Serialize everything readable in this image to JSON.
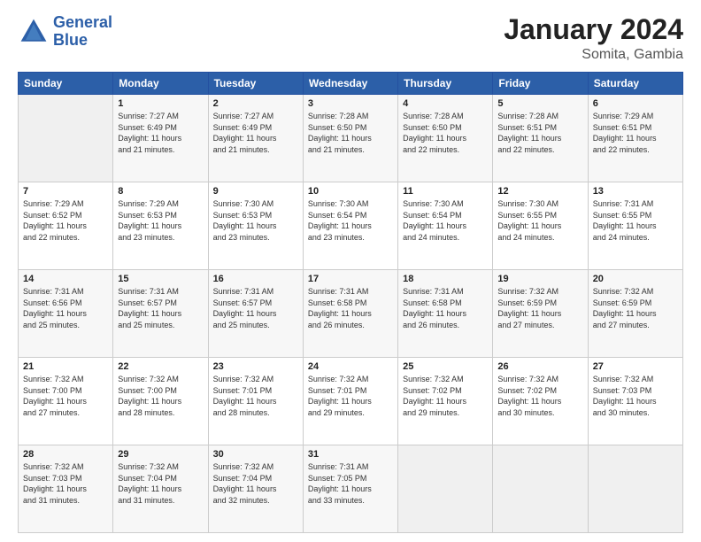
{
  "logo": {
    "line1": "General",
    "line2": "Blue"
  },
  "title": "January 2024",
  "subtitle": "Somita, Gambia",
  "days_header": [
    "Sunday",
    "Monday",
    "Tuesday",
    "Wednesday",
    "Thursday",
    "Friday",
    "Saturday"
  ],
  "weeks": [
    [
      {
        "day": "",
        "info": ""
      },
      {
        "day": "1",
        "info": "Sunrise: 7:27 AM\nSunset: 6:49 PM\nDaylight: 11 hours\nand 21 minutes."
      },
      {
        "day": "2",
        "info": "Sunrise: 7:27 AM\nSunset: 6:49 PM\nDaylight: 11 hours\nand 21 minutes."
      },
      {
        "day": "3",
        "info": "Sunrise: 7:28 AM\nSunset: 6:50 PM\nDaylight: 11 hours\nand 21 minutes."
      },
      {
        "day": "4",
        "info": "Sunrise: 7:28 AM\nSunset: 6:50 PM\nDaylight: 11 hours\nand 22 minutes."
      },
      {
        "day": "5",
        "info": "Sunrise: 7:28 AM\nSunset: 6:51 PM\nDaylight: 11 hours\nand 22 minutes."
      },
      {
        "day": "6",
        "info": "Sunrise: 7:29 AM\nSunset: 6:51 PM\nDaylight: 11 hours\nand 22 minutes."
      }
    ],
    [
      {
        "day": "7",
        "info": "Sunrise: 7:29 AM\nSunset: 6:52 PM\nDaylight: 11 hours\nand 22 minutes."
      },
      {
        "day": "8",
        "info": "Sunrise: 7:29 AM\nSunset: 6:53 PM\nDaylight: 11 hours\nand 23 minutes."
      },
      {
        "day": "9",
        "info": "Sunrise: 7:30 AM\nSunset: 6:53 PM\nDaylight: 11 hours\nand 23 minutes."
      },
      {
        "day": "10",
        "info": "Sunrise: 7:30 AM\nSunset: 6:54 PM\nDaylight: 11 hours\nand 23 minutes."
      },
      {
        "day": "11",
        "info": "Sunrise: 7:30 AM\nSunset: 6:54 PM\nDaylight: 11 hours\nand 24 minutes."
      },
      {
        "day": "12",
        "info": "Sunrise: 7:30 AM\nSunset: 6:55 PM\nDaylight: 11 hours\nand 24 minutes."
      },
      {
        "day": "13",
        "info": "Sunrise: 7:31 AM\nSunset: 6:55 PM\nDaylight: 11 hours\nand 24 minutes."
      }
    ],
    [
      {
        "day": "14",
        "info": "Sunrise: 7:31 AM\nSunset: 6:56 PM\nDaylight: 11 hours\nand 25 minutes."
      },
      {
        "day": "15",
        "info": "Sunrise: 7:31 AM\nSunset: 6:57 PM\nDaylight: 11 hours\nand 25 minutes."
      },
      {
        "day": "16",
        "info": "Sunrise: 7:31 AM\nSunset: 6:57 PM\nDaylight: 11 hours\nand 25 minutes."
      },
      {
        "day": "17",
        "info": "Sunrise: 7:31 AM\nSunset: 6:58 PM\nDaylight: 11 hours\nand 26 minutes."
      },
      {
        "day": "18",
        "info": "Sunrise: 7:31 AM\nSunset: 6:58 PM\nDaylight: 11 hours\nand 26 minutes."
      },
      {
        "day": "19",
        "info": "Sunrise: 7:32 AM\nSunset: 6:59 PM\nDaylight: 11 hours\nand 27 minutes."
      },
      {
        "day": "20",
        "info": "Sunrise: 7:32 AM\nSunset: 6:59 PM\nDaylight: 11 hours\nand 27 minutes."
      }
    ],
    [
      {
        "day": "21",
        "info": "Sunrise: 7:32 AM\nSunset: 7:00 PM\nDaylight: 11 hours\nand 27 minutes."
      },
      {
        "day": "22",
        "info": "Sunrise: 7:32 AM\nSunset: 7:00 PM\nDaylight: 11 hours\nand 28 minutes."
      },
      {
        "day": "23",
        "info": "Sunrise: 7:32 AM\nSunset: 7:01 PM\nDaylight: 11 hours\nand 28 minutes."
      },
      {
        "day": "24",
        "info": "Sunrise: 7:32 AM\nSunset: 7:01 PM\nDaylight: 11 hours\nand 29 minutes."
      },
      {
        "day": "25",
        "info": "Sunrise: 7:32 AM\nSunset: 7:02 PM\nDaylight: 11 hours\nand 29 minutes."
      },
      {
        "day": "26",
        "info": "Sunrise: 7:32 AM\nSunset: 7:02 PM\nDaylight: 11 hours\nand 30 minutes."
      },
      {
        "day": "27",
        "info": "Sunrise: 7:32 AM\nSunset: 7:03 PM\nDaylight: 11 hours\nand 30 minutes."
      }
    ],
    [
      {
        "day": "28",
        "info": "Sunrise: 7:32 AM\nSunset: 7:03 PM\nDaylight: 11 hours\nand 31 minutes."
      },
      {
        "day": "29",
        "info": "Sunrise: 7:32 AM\nSunset: 7:04 PM\nDaylight: 11 hours\nand 31 minutes."
      },
      {
        "day": "30",
        "info": "Sunrise: 7:32 AM\nSunset: 7:04 PM\nDaylight: 11 hours\nand 32 minutes."
      },
      {
        "day": "31",
        "info": "Sunrise: 7:31 AM\nSunset: 7:05 PM\nDaylight: 11 hours\nand 33 minutes."
      },
      {
        "day": "",
        "info": ""
      },
      {
        "day": "",
        "info": ""
      },
      {
        "day": "",
        "info": ""
      }
    ]
  ]
}
